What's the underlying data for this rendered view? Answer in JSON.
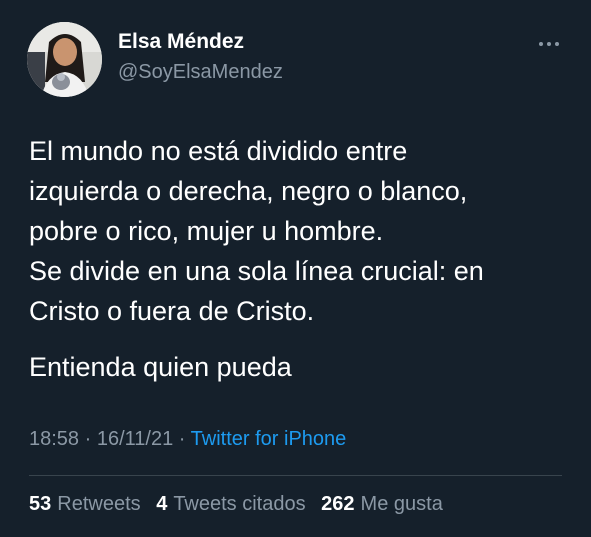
{
  "colors": {
    "background": "#15202b",
    "primary_text": "#ffffff",
    "secondary_text": "#8b98a5",
    "link": "#1d9bf0",
    "divider": "#38444d"
  },
  "author": {
    "display_name": "Elsa Méndez",
    "handle": "@SoyElsaMendez",
    "avatar_icon": "profile-photo"
  },
  "menu": {
    "icon": "more-icon"
  },
  "tweet": {
    "lines": [
      "El mundo no está dividido entre",
      "izquierda o derecha, negro o blanco,",
      "pobre o rico, mujer u hombre.",
      "Se divide en una sola línea crucial: en",
      "Cristo o fuera de Cristo."
    ],
    "closing_line": "Entienda quien pueda"
  },
  "meta": {
    "time": "18:58",
    "separator": "·",
    "date": "16/11/21",
    "source": "Twitter for iPhone"
  },
  "stats": {
    "retweets_count": "53",
    "retweets_label": "Retweets",
    "quotes_count": "4",
    "quotes_label": "Tweets citados",
    "likes_count": "262",
    "likes_label": "Me gusta"
  }
}
